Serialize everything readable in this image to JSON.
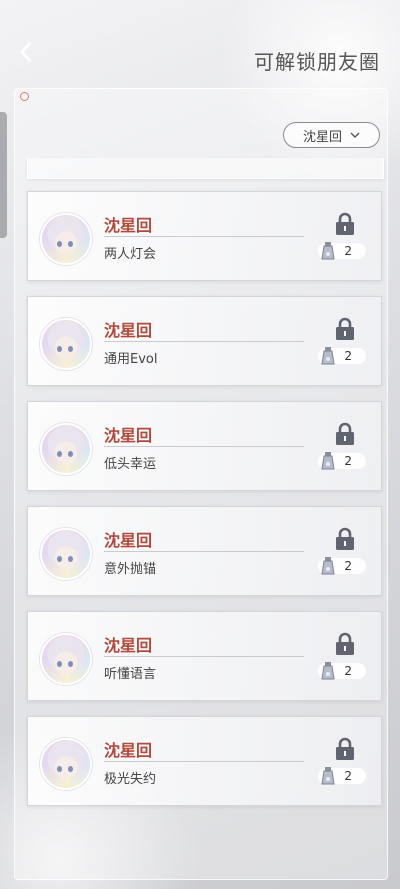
{
  "header": {
    "title": "可解锁朋友圈"
  },
  "filter": {
    "selected": "沈星回"
  },
  "cards": [
    {
      "name": "沈星回",
      "desc": "两人灯会",
      "count": "2"
    },
    {
      "name": "沈星回",
      "desc": "通用Evol",
      "count": "2"
    },
    {
      "name": "沈星回",
      "desc": "低头幸运",
      "count": "2"
    },
    {
      "name": "沈星回",
      "desc": "意外抛锚",
      "count": "2"
    },
    {
      "name": "沈星回",
      "desc": "听懂语言",
      "count": "2"
    },
    {
      "name": "沈星回",
      "desc": "极光失约",
      "count": "2"
    }
  ],
  "colors": {
    "accent": "#b24a3c",
    "text": "#444444"
  },
  "icons": {
    "back": "chevron-left-icon",
    "lock": "lock-icon",
    "dropdown": "chevron-down-icon",
    "item": "vial-icon"
  }
}
